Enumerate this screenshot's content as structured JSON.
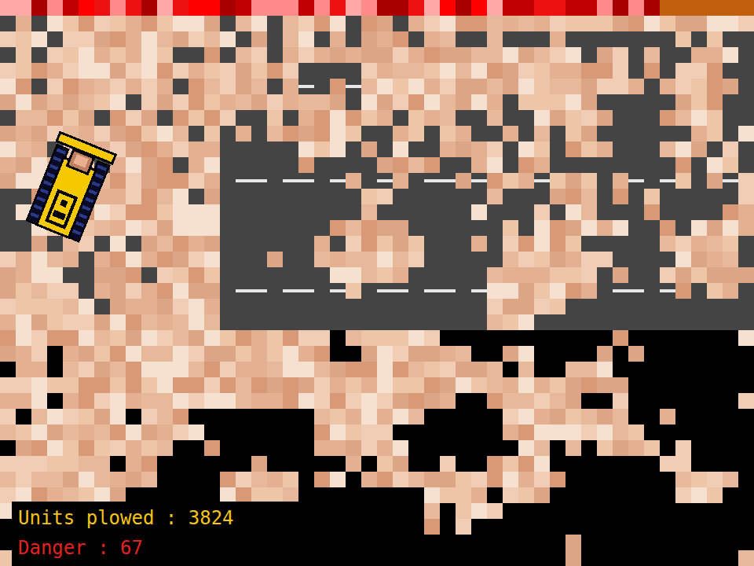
{
  "danger_bar": {
    "level": 0.875
  },
  "hud": {
    "stats": [
      {
        "text": "Units plowed : 3824",
        "color": "#f5c518"
      },
      {
        "text": "Danger : 67",
        "color": "#e52222"
      }
    ]
  }
}
